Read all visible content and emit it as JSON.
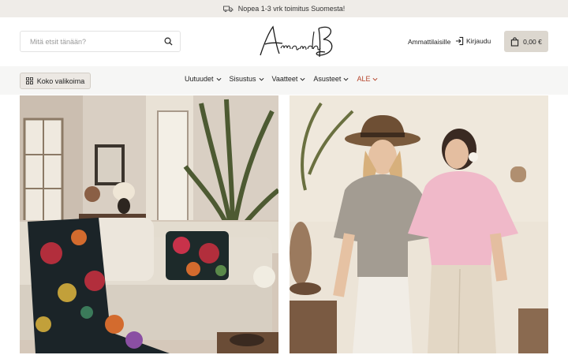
{
  "announcement": {
    "icon": "truck-icon",
    "text": "Nopea 1-3 vrk toimitus Suomesta!"
  },
  "header": {
    "search_placeholder": "Mitä etsit tänään?",
    "search_icon": "search-icon",
    "logo_text": "AmandaB",
    "pro_link": "Ammattilaisille",
    "login_label": "Kirjaudu",
    "login_icon": "login-icon",
    "cart_total": "0,00 €",
    "cart_icon": "shopping-bag-icon"
  },
  "navbar": {
    "catalog_label": "Koko valikoima",
    "catalog_icon": "grid-icon",
    "items": [
      {
        "label": "Uutuudet"
      },
      {
        "label": "Sisustus"
      },
      {
        "label": "Vaatteet"
      },
      {
        "label": "Asusteet"
      },
      {
        "label": "ALE"
      }
    ],
    "sale_color": "#b5452c"
  },
  "colors": {
    "announce_bg": "#efece8",
    "cart_bg": "#dcd7cf",
    "nav_bg": "#f6f6f5"
  }
}
